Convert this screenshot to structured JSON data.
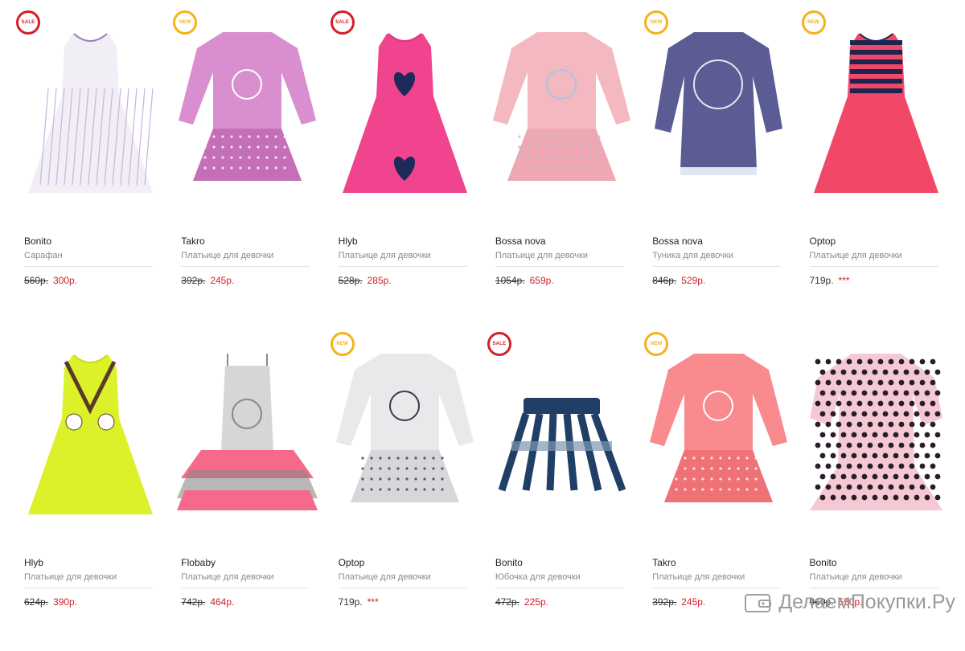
{
  "products": [
    {
      "brand": "Bonito",
      "subtitle": "Сарафан",
      "old_price": "560р.",
      "price": "300р.",
      "badge": "SALE",
      "garment": "dress-sleeveless",
      "colors": {
        "main": "#f2eef5",
        "accent": "#9b7ac6",
        "detail": "#c7b4e0"
      }
    },
    {
      "brand": "Takro",
      "subtitle": "Платьице для девочки",
      "old_price": "392р.",
      "price": "245р.",
      "badge": "NEW",
      "garment": "dress-longsleeve",
      "colors": {
        "main": "#d98fcf",
        "accent": "#c46fb8",
        "detail": "#ffffff"
      }
    },
    {
      "brand": "Hlyb",
      "subtitle": "Платьице для девочки",
      "old_price": "528р.",
      "price": "285р.",
      "badge": "SALE",
      "garment": "dress-tank",
      "colors": {
        "main": "#f0448e",
        "accent": "#e1347c",
        "detail": "#1d2a5a"
      }
    },
    {
      "brand": "Bossa nova",
      "subtitle": "Платьице для девочки",
      "old_price": "1054р.",
      "price": "659р.",
      "badge": "",
      "garment": "dress-longsleeve",
      "colors": {
        "main": "#f3b8c0",
        "accent": "#efa8b2",
        "detail": "#a9c6e0"
      }
    },
    {
      "brand": "Bossa nova",
      "subtitle": "Туника для девочки",
      "old_price": "846р.",
      "price": "529р.",
      "badge": "NEW",
      "garment": "tunic",
      "colors": {
        "main": "#5b5c93",
        "accent": "#4b4c80",
        "detail": "#dfe8f0"
      }
    },
    {
      "brand": "Optop",
      "subtitle": "Платьице для девочки",
      "old_price": "",
      "price": "719р.",
      "stars": "***",
      "badge": "NEW",
      "garment": "dress-stripe",
      "colors": {
        "main": "#f24868",
        "accent": "#1e2450",
        "detail": "#f24868"
      }
    },
    {
      "brand": "Hlyb",
      "subtitle": "Платьице для девочки",
      "old_price": "624р.",
      "price": "390р.",
      "badge": "",
      "garment": "dress-neon",
      "colors": {
        "main": "#dcf12a",
        "accent": "#c6db1c",
        "detail": "#5a3a2a"
      }
    },
    {
      "brand": "Flobaby",
      "subtitle": "Платьице для девочки",
      "old_price": "742р.",
      "price": "464р.",
      "badge": "",
      "garment": "dress-ruffle",
      "colors": {
        "main": "#d6d6d6",
        "accent": "#f56a8a",
        "detail": "#888888"
      }
    },
    {
      "brand": "Optop",
      "subtitle": "Платьице для девочки",
      "old_price": "",
      "price": "719р.",
      "stars": "***",
      "badge": "NEW",
      "garment": "dress-longsleeve",
      "colors": {
        "main": "#e9e9ec",
        "accent": "#d6d6db",
        "detail": "#3a3a4a"
      }
    },
    {
      "brand": "Bonito",
      "subtitle": "Юбочка для девочки",
      "old_price": "472р.",
      "price": "225р.",
      "badge": "SALE",
      "garment": "skirt",
      "colors": {
        "main": "#1f3f66",
        "accent": "#ffffff",
        "detail": "#7f96b3"
      }
    },
    {
      "brand": "Takro",
      "subtitle": "Платьице для девочки",
      "old_price": "392р.",
      "price": "245р.",
      "badge": "NEW",
      "garment": "dress-longsleeve",
      "colors": {
        "main": "#f98a8e",
        "accent": "#ef7277",
        "detail": "#ffffff"
      }
    },
    {
      "brand": "Bonito",
      "subtitle": "Платьице для девочки",
      "old_price": "960р.",
      "price": "550р.",
      "badge": "",
      "garment": "dress-dots",
      "colors": {
        "main": "#f4c9d4",
        "accent": "#2a1d2a",
        "detail": "#f4c9d4"
      }
    }
  ],
  "watermark": {
    "text": "ДелаемПокупки.Ру",
    "icon": "wallet-icon"
  }
}
